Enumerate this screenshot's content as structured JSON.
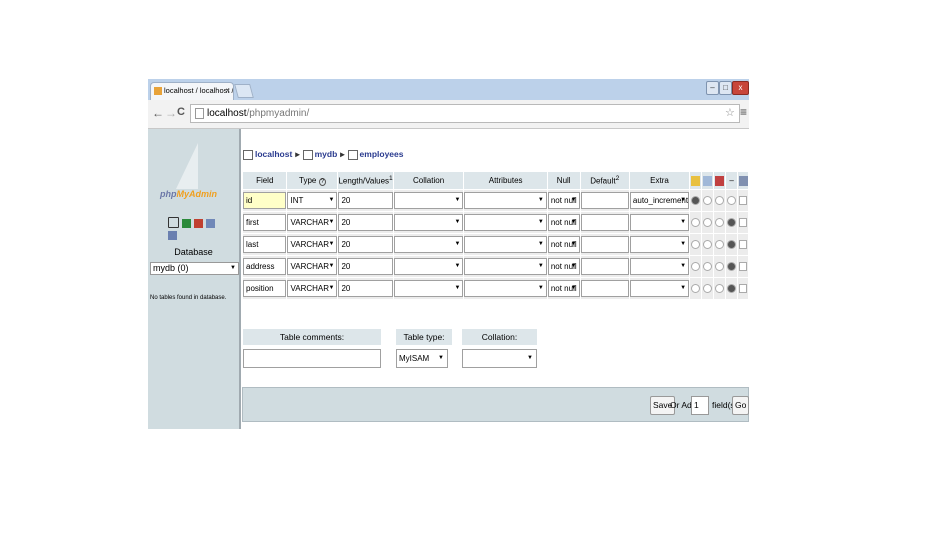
{
  "browser": {
    "tab_title": "localhost / localhost / my",
    "tab_close": "×",
    "url_host": "localhost",
    "url_path": "/phpmyadmin/",
    "back": "←",
    "forward": "→",
    "reload": "C",
    "star": "☆",
    "menu": "≡",
    "win_min": "–",
    "win_max": "□",
    "win_close": "x"
  },
  "sidebar": {
    "logo_a": "php",
    "logo_b": "MyAdmin",
    "icons": [
      "home-icon",
      "sql-icon",
      "query-icon",
      "docs-icon",
      "settings-icon"
    ],
    "database_label": "Database",
    "database_select": "mydb (0)",
    "no_tables": "No tables found in database."
  },
  "breadcrumb": {
    "server": "localhost",
    "database": "mydb",
    "table": "employees"
  },
  "fields_table": {
    "headers": {
      "field": "Field",
      "type": "Type",
      "type_help": "?",
      "length": "Length/Values",
      "length_sup": "1",
      "collation": "Collation",
      "attributes": "Attributes",
      "null": "Null",
      "default": "Default",
      "default_sup": "2",
      "extra": "Extra"
    },
    "header_icons": [
      "primary-key-icon",
      "index-icon",
      "unique-icon",
      "dash-icon",
      "fulltext-icon"
    ],
    "rows": [
      {
        "field": "id",
        "type": "INT",
        "length": "20",
        "collation": "",
        "attributes": "",
        "null": "not null",
        "default": "",
        "extra": "auto_increment",
        "primary": true
      },
      {
        "field": "first",
        "type": "VARCHAR",
        "length": "20",
        "collation": "",
        "attributes": "",
        "null": "not null",
        "default": "",
        "extra": "",
        "primary": false
      },
      {
        "field": "last",
        "type": "VARCHAR",
        "length": "20",
        "collation": "",
        "attributes": "",
        "null": "not null",
        "default": "",
        "extra": "",
        "primary": false
      },
      {
        "field": "address",
        "type": "VARCHAR",
        "length": "20",
        "collation": "",
        "attributes": "",
        "null": "not null",
        "default": "",
        "extra": "",
        "primary": false
      },
      {
        "field": "position",
        "type": "VARCHAR",
        "length": "20",
        "collation": "",
        "attributes": "",
        "null": "not null",
        "default": "",
        "extra": "",
        "primary": false
      }
    ]
  },
  "table_options": {
    "comments_label": "Table comments:",
    "comments_value": "",
    "type_label": "Table type:",
    "type_value": "MyISAM",
    "collation_label": "Collation:",
    "collation_value": ""
  },
  "footer": {
    "save": "Save",
    "or_add": "Or Add",
    "add_count": "1",
    "fields_suffix": "field(s)",
    "go": "Go"
  },
  "colors": {
    "titlebar": "#bcd1ea",
    "sidebar": "#d0dce0",
    "header_cell": "#dde6ea",
    "link": "#2a3b8f",
    "highlight_input": "#ffffc8"
  }
}
